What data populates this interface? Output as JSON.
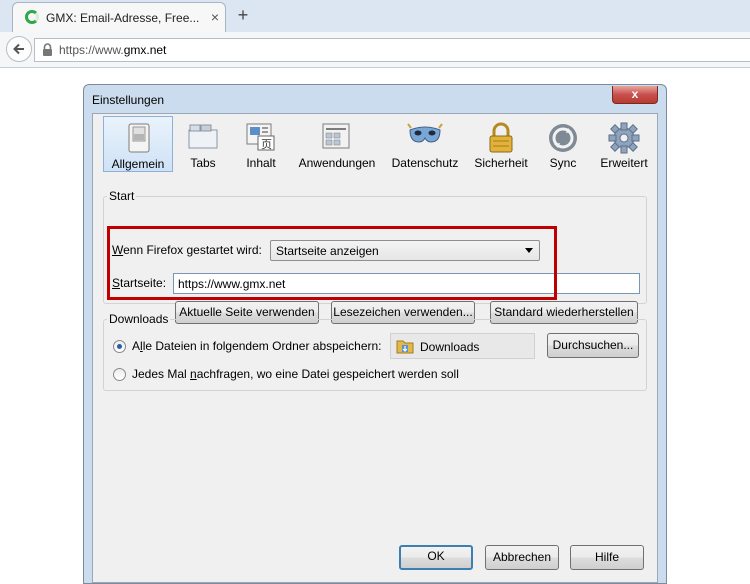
{
  "browser": {
    "tab_title": "GMX: Email-Adresse, Free...",
    "tab_close": "×",
    "new_tab": "+",
    "url_prefix": "https://www.",
    "url_host": "gmx.net"
  },
  "dialog": {
    "title": "Einstellungen",
    "close": "x",
    "panes": [
      {
        "label": "Allgemein",
        "icon": "general-switch-icon",
        "selected": true
      },
      {
        "label": "Tabs",
        "icon": "tabs-icon",
        "selected": false
      },
      {
        "label": "Inhalt",
        "icon": "content-icon",
        "selected": false
      },
      {
        "label": "Anwendungen",
        "icon": "applications-icon",
        "selected": false
      },
      {
        "label": "Datenschutz",
        "icon": "privacy-mask-icon",
        "selected": false
      },
      {
        "label": "Sicherheit",
        "icon": "lock-icon",
        "selected": false
      },
      {
        "label": "Sync",
        "icon": "sync-icon",
        "selected": false
      },
      {
        "label": "Erweitert",
        "icon": "gear-icon",
        "selected": false
      }
    ],
    "start": {
      "caption": "Start",
      "when_label_u": "W",
      "when_label_rest": "enn Firefox gestartet wird:",
      "when_value": "Startseite anzeigen",
      "home_label_u": "S",
      "home_label_rest": "tartseite:",
      "home_value": "https://www.gmx.net",
      "btn_current": "Aktuelle Seite verwenden",
      "btn_bookmark": "Lesezeichen verwenden...",
      "btn_default": "Standard wiederherstellen",
      "highlight_color": "#c00000"
    },
    "downloads": {
      "caption": "Downloads",
      "save_all_u": "l",
      "save_all_pre": "A",
      "save_all_rest": "le Dateien in folgendem Ordner abspeichern:",
      "folder": "Downloads",
      "browse": "Durchsuchen...",
      "ask_pre": "Jedes Mal ",
      "ask_u": "n",
      "ask_rest": "achfragen, wo eine Datei gespeichert werden soll"
    },
    "buttons": {
      "ok": "OK",
      "cancel": "Abbrechen",
      "help": "Hilfe"
    }
  }
}
